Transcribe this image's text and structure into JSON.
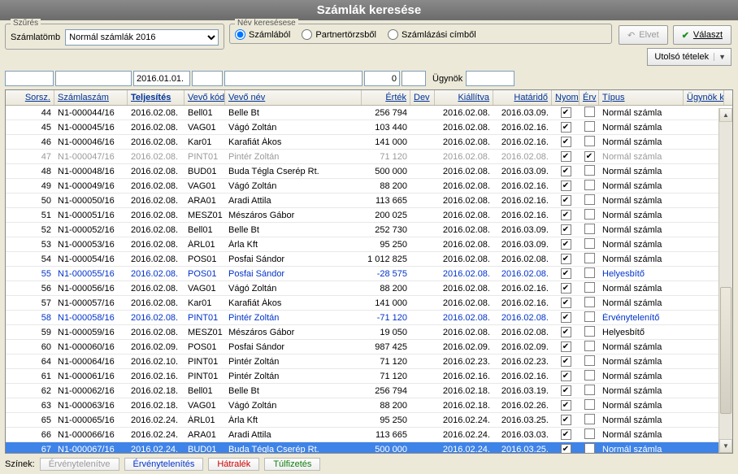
{
  "title": "Számlák keresése",
  "filter": {
    "legend": "Szűrés",
    "label": "Számlatömb",
    "value": "Normál számlák 2016"
  },
  "name_search": {
    "legend": "Név keresésese",
    "opt1": "Számlából",
    "opt2": "Partnertörzsből",
    "opt3": "Számlázási címből"
  },
  "buttons": {
    "elvet": "Elvet",
    "valaszt": "Választ",
    "utolso": "Utolsó tételek"
  },
  "filterbar": {
    "telj": "2016.01.01.",
    "ertek": "0",
    "ugynok_label": "Ügynök"
  },
  "headers": {
    "sorsz": "Sorsz.",
    "szam": "Számlaszám",
    "telj": "Teljesítés",
    "vkod": "Vevő kód",
    "vnev": "Vevő név",
    "ertek": "Érték",
    "dev": "Dev",
    "kiall": "Kiállítva",
    "hatar": "Határidő",
    "nyom": "Nyom",
    "erv": "Érv",
    "tipus": "Típus",
    "ugynok": "Ügynök kó"
  },
  "rows": [
    {
      "sorsz": "44",
      "szam": "N1-000044/16",
      "telj": "2016.02.08.",
      "vkod": "Bell01",
      "vnev": "Belle Bt",
      "ertek": "256 794",
      "kiall": "2016.02.08.",
      "hatar": "2016.03.09.",
      "nyom": true,
      "erv": false,
      "tipus": "Normál számla",
      "style": ""
    },
    {
      "sorsz": "45",
      "szam": "N1-000045/16",
      "telj": "2016.02.08.",
      "vkod": "VAG01",
      "vnev": "Vágó Zoltán",
      "ertek": "103 440",
      "kiall": "2016.02.08.",
      "hatar": "2016.02.16.",
      "nyom": true,
      "erv": false,
      "tipus": "Normál számla",
      "style": ""
    },
    {
      "sorsz": "46",
      "szam": "N1-000046/16",
      "telj": "2016.02.08.",
      "vkod": "Kar01",
      "vnev": "Karafiát Ákos",
      "ertek": "141 000",
      "kiall": "2016.02.08.",
      "hatar": "2016.02.16.",
      "nyom": true,
      "erv": false,
      "tipus": "Normál számla",
      "style": ""
    },
    {
      "sorsz": "47",
      "szam": "N1-000047/16",
      "telj": "2016.02.08.",
      "vkod": "PINT01",
      "vnev": "Pintér Zoltán",
      "ertek": "71 120",
      "kiall": "2016.02.08.",
      "hatar": "2016.02.08.",
      "nyom": true,
      "erv": true,
      "tipus": "Normál számla",
      "style": "gray"
    },
    {
      "sorsz": "48",
      "szam": "N1-000048/16",
      "telj": "2016.02.08.",
      "vkod": "BUD01",
      "vnev": "Buda Tégla Cserép Rt.",
      "ertek": "500 000",
      "kiall": "2016.02.08.",
      "hatar": "2016.03.09.",
      "nyom": true,
      "erv": false,
      "tipus": "Normál számla",
      "style": ""
    },
    {
      "sorsz": "49",
      "szam": "N1-000049/16",
      "telj": "2016.02.08.",
      "vkod": "VAG01",
      "vnev": "Vágó Zoltán",
      "ertek": "88 200",
      "kiall": "2016.02.08.",
      "hatar": "2016.02.16.",
      "nyom": true,
      "erv": false,
      "tipus": "Normál számla",
      "style": ""
    },
    {
      "sorsz": "50",
      "szam": "N1-000050/16",
      "telj": "2016.02.08.",
      "vkod": "ARA01",
      "vnev": "Aradi Attila",
      "ertek": "113 665",
      "kiall": "2016.02.08.",
      "hatar": "2016.02.16.",
      "nyom": true,
      "erv": false,
      "tipus": "Normál számla",
      "style": ""
    },
    {
      "sorsz": "51",
      "szam": "N1-000051/16",
      "telj": "2016.02.08.",
      "vkod": "MESZ01",
      "vnev": "Mészáros Gábor",
      "ertek": "200 025",
      "kiall": "2016.02.08.",
      "hatar": "2016.02.16.",
      "nyom": true,
      "erv": false,
      "tipus": "Normál számla",
      "style": ""
    },
    {
      "sorsz": "52",
      "szam": "N1-000052/16",
      "telj": "2016.02.08.",
      "vkod": "Bell01",
      "vnev": "Belle Bt",
      "ertek": "252 730",
      "kiall": "2016.02.08.",
      "hatar": "2016.03.09.",
      "nyom": true,
      "erv": false,
      "tipus": "Normál számla",
      "style": ""
    },
    {
      "sorsz": "53",
      "szam": "N1-000053/16",
      "telj": "2016.02.08.",
      "vkod": "ÁRL01",
      "vnev": "Árla Kft",
      "ertek": "95 250",
      "kiall": "2016.02.08.",
      "hatar": "2016.03.09.",
      "nyom": true,
      "erv": false,
      "tipus": "Normál számla",
      "style": ""
    },
    {
      "sorsz": "54",
      "szam": "N1-000054/16",
      "telj": "2016.02.08.",
      "vkod": "POS01",
      "vnev": "Posfai Sándor",
      "ertek": "1 012 825",
      "kiall": "2016.02.08.",
      "hatar": "2016.02.08.",
      "nyom": true,
      "erv": false,
      "tipus": "Normál számla",
      "style": ""
    },
    {
      "sorsz": "55",
      "szam": "N1-000055/16",
      "telj": "2016.02.08.",
      "vkod": "POS01",
      "vnev": "Posfai Sándor",
      "ertek": "-28 575",
      "kiall": "2016.02.08.",
      "hatar": "2016.02.08.",
      "nyom": true,
      "erv": false,
      "tipus": "Helyesbítő",
      "style": "blue"
    },
    {
      "sorsz": "56",
      "szam": "N1-000056/16",
      "telj": "2016.02.08.",
      "vkod": "VAG01",
      "vnev": "Vágó Zoltán",
      "ertek": "88 200",
      "kiall": "2016.02.08.",
      "hatar": "2016.02.16.",
      "nyom": true,
      "erv": false,
      "tipus": "Normál számla",
      "style": ""
    },
    {
      "sorsz": "57",
      "szam": "N1-000057/16",
      "telj": "2016.02.08.",
      "vkod": "Kar01",
      "vnev": "Karafiát Ákos",
      "ertek": "141 000",
      "kiall": "2016.02.08.",
      "hatar": "2016.02.16.",
      "nyom": true,
      "erv": false,
      "tipus": "Normál számla",
      "style": ""
    },
    {
      "sorsz": "58",
      "szam": "N1-000058/16",
      "telj": "2016.02.08.",
      "vkod": "PINT01",
      "vnev": "Pintér Zoltán",
      "ertek": "-71 120",
      "kiall": "2016.02.08.",
      "hatar": "2016.02.08.",
      "nyom": true,
      "erv": false,
      "tipus": "Érvénytelenítő",
      "style": "blue"
    },
    {
      "sorsz": "59",
      "szam": "N1-000059/16",
      "telj": "2016.02.08.",
      "vkod": "MESZ01",
      "vnev": "Mészáros Gábor",
      "ertek": "19 050",
      "kiall": "2016.02.08.",
      "hatar": "2016.02.08.",
      "nyom": true,
      "erv": false,
      "tipus": "Helyesbítő",
      "style": ""
    },
    {
      "sorsz": "60",
      "szam": "N1-000060/16",
      "telj": "2016.02.09.",
      "vkod": "POS01",
      "vnev": "Posfai Sándor",
      "ertek": "987 425",
      "kiall": "2016.02.09.",
      "hatar": "2016.02.09.",
      "nyom": true,
      "erv": false,
      "tipus": "Normál számla",
      "style": ""
    },
    {
      "sorsz": "64",
      "szam": "N1-000064/16",
      "telj": "2016.02.10.",
      "vkod": "PINT01",
      "vnev": "Pintér Zoltán",
      "ertek": "71 120",
      "kiall": "2016.02.23.",
      "hatar": "2016.02.23.",
      "nyom": true,
      "erv": false,
      "tipus": "Normál számla",
      "style": ""
    },
    {
      "sorsz": "61",
      "szam": "N1-000061/16",
      "telj": "2016.02.16.",
      "vkod": "PINT01",
      "vnev": "Pintér Zoltán",
      "ertek": "71 120",
      "kiall": "2016.02.16.",
      "hatar": "2016.02.16.",
      "nyom": true,
      "erv": false,
      "tipus": "Normál számla",
      "style": ""
    },
    {
      "sorsz": "62",
      "szam": "N1-000062/16",
      "telj": "2016.02.18.",
      "vkod": "Bell01",
      "vnev": "Belle Bt",
      "ertek": "256 794",
      "kiall": "2016.02.18.",
      "hatar": "2016.03.19.",
      "nyom": true,
      "erv": false,
      "tipus": "Normál számla",
      "style": ""
    },
    {
      "sorsz": "63",
      "szam": "N1-000063/16",
      "telj": "2016.02.18.",
      "vkod": "VAG01",
      "vnev": "Vágó Zoltán",
      "ertek": "88 200",
      "kiall": "2016.02.18.",
      "hatar": "2016.02.26.",
      "nyom": true,
      "erv": false,
      "tipus": "Normál számla",
      "style": ""
    },
    {
      "sorsz": "65",
      "szam": "N1-000065/16",
      "telj": "2016.02.24.",
      "vkod": "ÁRL01",
      "vnev": "Árla Kft",
      "ertek": "95 250",
      "kiall": "2016.02.24.",
      "hatar": "2016.03.25.",
      "nyom": true,
      "erv": false,
      "tipus": "Normál számla",
      "style": ""
    },
    {
      "sorsz": "66",
      "szam": "N1-000066/16",
      "telj": "2016.02.24.",
      "vkod": "ARA01",
      "vnev": "Aradi Attila",
      "ertek": "113 665",
      "kiall": "2016.02.24.",
      "hatar": "2016.03.03.",
      "nyom": true,
      "erv": false,
      "tipus": "Normál számla",
      "style": ""
    },
    {
      "sorsz": "67",
      "szam": "N1-000067/16",
      "telj": "2016.02.24.",
      "vkod": "BUD01",
      "vnev": "Buda Tégla Cserép Rt.",
      "ertek": "500 000",
      "kiall": "2016.02.24.",
      "hatar": "2016.03.25.",
      "nyom": true,
      "erv": false,
      "tipus": "Normál számla",
      "style": "sel"
    }
  ],
  "footer": {
    "label": "Színek:",
    "l1": "Érvénytelenítve",
    "l2": "Érvénytelenítés",
    "l3": "Hátralék",
    "l4": "Túlfizetés"
  }
}
